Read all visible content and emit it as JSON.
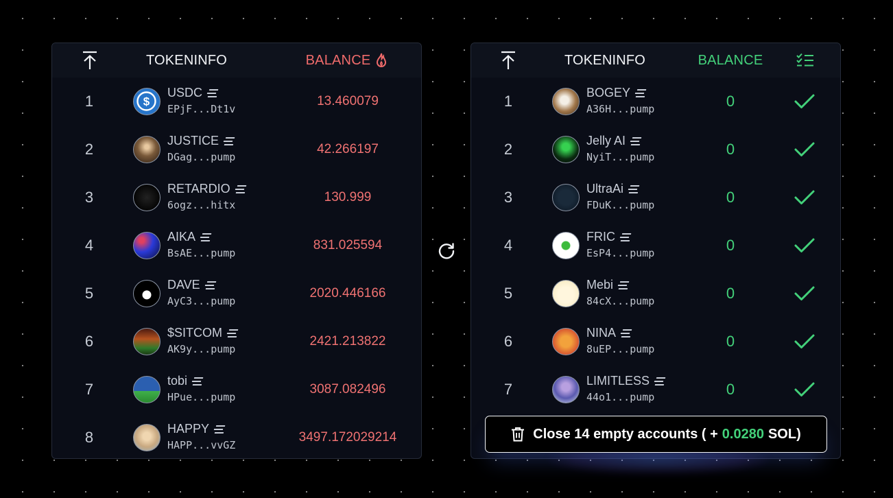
{
  "left_table": {
    "header": {
      "tokeninfo": "TOKENINFO",
      "balance": "BALANCE"
    },
    "rows": [
      {
        "rank": "1",
        "name": "USDC",
        "address": "EPjF...Dt1v",
        "balance": "13.460079"
      },
      {
        "rank": "2",
        "name": "JUSTICE",
        "address": "DGag...pump",
        "balance": "42.266197"
      },
      {
        "rank": "3",
        "name": "RETARDIO",
        "address": "6ogz...hitx",
        "balance": "130.999"
      },
      {
        "rank": "4",
        "name": "AIKA",
        "address": "BsAE...pump",
        "balance": "831.025594"
      },
      {
        "rank": "5",
        "name": "DAVE",
        "address": "AyC3...pump",
        "balance": "2020.446166"
      },
      {
        "rank": "6",
        "name": "$SITCOM",
        "address": "AK9y...pump",
        "balance": "2421.213822"
      },
      {
        "rank": "7",
        "name": "tobi",
        "address": "HPue...pump",
        "balance": "3087.082496"
      },
      {
        "rank": "8",
        "name": "HAPPY",
        "address": "HAPP...vvGZ",
        "balance": "3497.172029214"
      }
    ]
  },
  "right_table": {
    "header": {
      "tokeninfo": "TOKENINFO",
      "balance": "BALANCE"
    },
    "rows": [
      {
        "rank": "1",
        "name": "BOGEY",
        "address": "A36H...pump",
        "balance": "0"
      },
      {
        "rank": "2",
        "name": "Jelly AI",
        "address": "NyiT...pump",
        "balance": "0"
      },
      {
        "rank": "3",
        "name": "UltraAi",
        "address": "FDuK...pump",
        "balance": "0"
      },
      {
        "rank": "4",
        "name": "FRIC",
        "address": "EsP4...pump",
        "balance": "0"
      },
      {
        "rank": "5",
        "name": "Mebi",
        "address": "84cX...pump",
        "balance": "0"
      },
      {
        "rank": "6",
        "name": "NINA",
        "address": "8uEP...pump",
        "balance": "0"
      },
      {
        "rank": "7",
        "name": "LIMITLESS",
        "address": "44o1...pump",
        "balance": "0"
      }
    ]
  },
  "close_button": {
    "prefix": "Close 14 empty accounts ( +",
    "amount": "0.0280",
    "suffix": "SOL)"
  },
  "colors": {
    "accent_red": "#f07272",
    "accent_green": "#43d17a",
    "panel_bg": "#0a0d17"
  },
  "icons": {
    "sort_top": "arrow-up-to-top-icon",
    "fire": "flame-icon",
    "checklist": "checklist-icon",
    "check": "check-icon",
    "refresh": "refresh-icon",
    "trash": "trash-icon",
    "solana": "solana-icon"
  }
}
